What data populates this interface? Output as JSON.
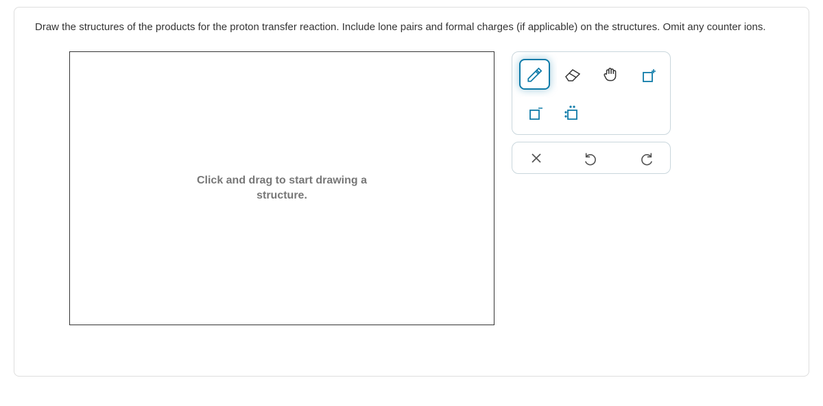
{
  "question": "Draw the structures of the products for the proton transfer reaction. Include lone pairs and formal charges (if applicable) on the structures. Omit any counter ions.",
  "canvas": {
    "placeholder": "Click and drag to start drawing a\nstructure."
  },
  "tools": {
    "pencil": "pencil",
    "eraser": "eraser",
    "hand": "hand",
    "positive_charge": "positive-charge",
    "negative_charge": "negative-charge",
    "lone_pair": "lone-pair"
  },
  "actions": {
    "clear": "clear",
    "undo": "undo",
    "redo": "redo"
  },
  "colors": {
    "accent": "#0d7aa8"
  }
}
